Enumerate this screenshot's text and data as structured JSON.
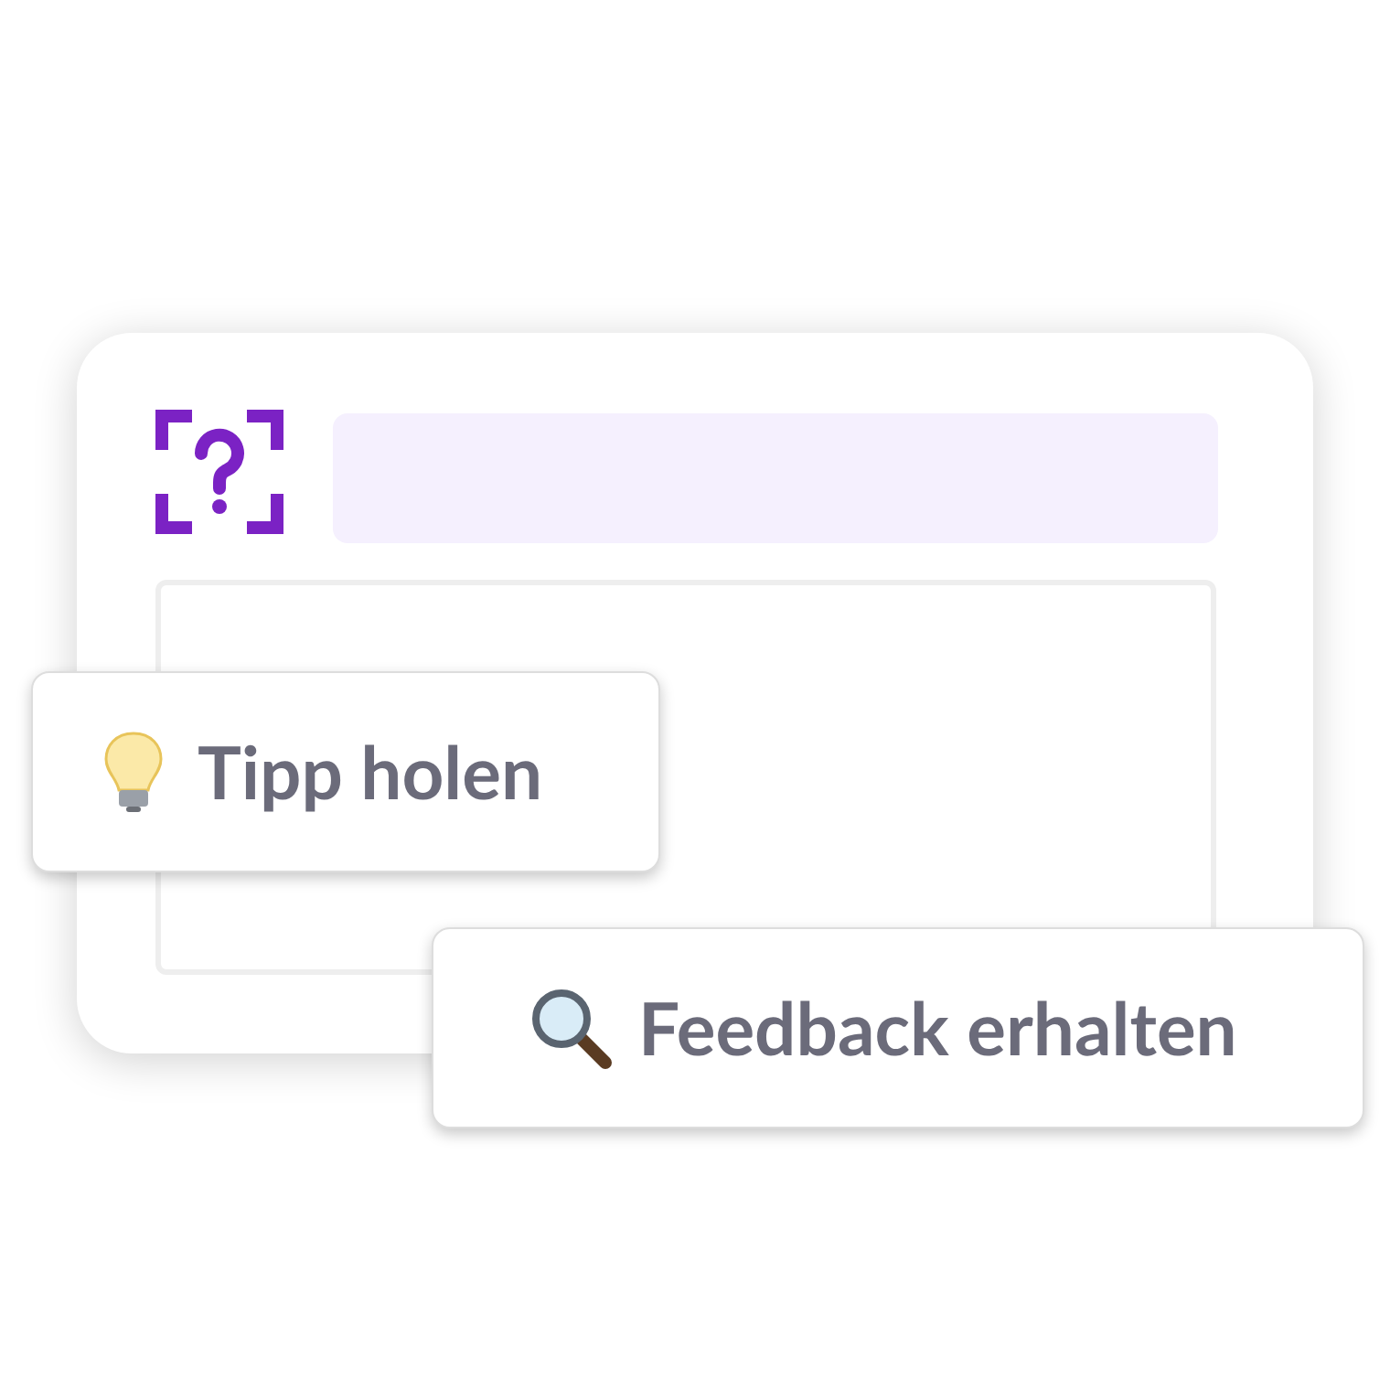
{
  "buttons": [
    {
      "label": "Tipp holen"
    },
    {
      "label": "Feedback erhalten"
    }
  ]
}
